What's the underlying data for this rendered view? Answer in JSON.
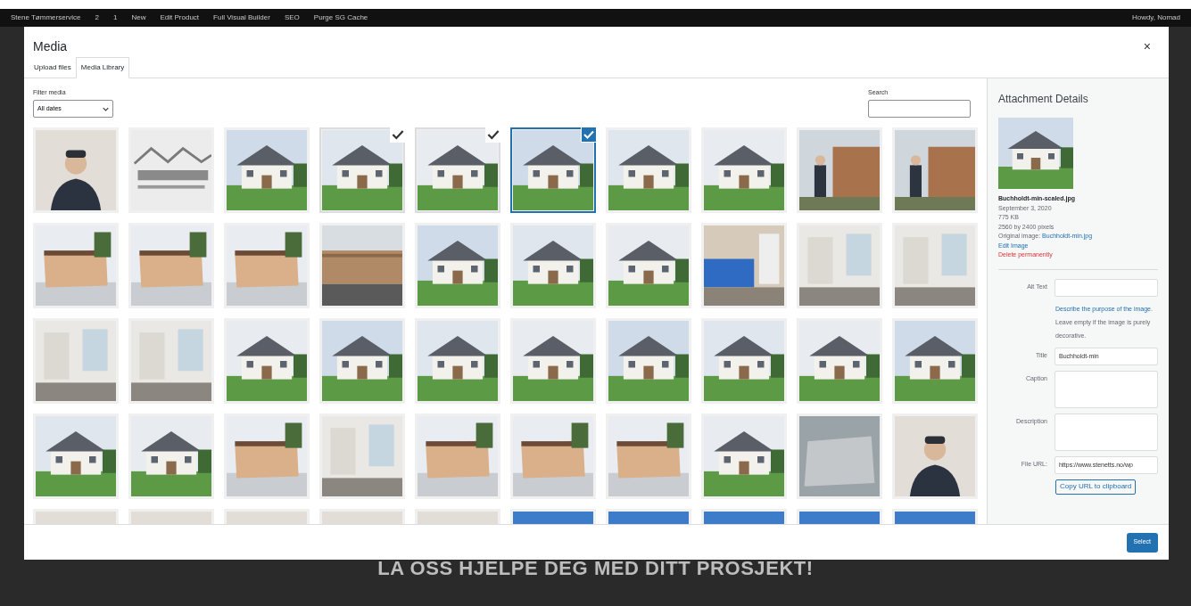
{
  "admin_bar": {
    "site": "Stene Tømmerservice",
    "updates": "2",
    "comments": "1",
    "new": "New",
    "edit": "Edit Product",
    "builder": "Full Visual Builder",
    "seo": "SEO",
    "cache": "Purge SG Cache",
    "greeting": "Howdy, Nomad"
  },
  "modal": {
    "title": "Media",
    "close": "×",
    "tabs": [
      {
        "label": "Upload files",
        "selected": false
      },
      {
        "label": "Media Library",
        "selected": true
      }
    ]
  },
  "filter": {
    "label": "Filter media",
    "value": "All dates"
  },
  "search": {
    "label": "Search"
  },
  "attachments": [
    {
      "selected": false,
      "current": false
    },
    {
      "selected": false,
      "current": false
    },
    {
      "selected": false,
      "current": false
    },
    {
      "selected": true,
      "current": false
    },
    {
      "selected": true,
      "current": false
    },
    {
      "selected": true,
      "current": true
    },
    {
      "selected": false,
      "current": false
    },
    {
      "selected": false,
      "current": false
    },
    {
      "selected": false,
      "current": false
    },
    {
      "selected": false,
      "current": false
    },
    {
      "selected": false,
      "current": false
    },
    {
      "selected": false,
      "current": false
    },
    {
      "selected": false,
      "current": false
    },
    {
      "selected": false,
      "current": false
    },
    {
      "selected": false,
      "current": false
    },
    {
      "selected": false,
      "current": false
    },
    {
      "selected": false,
      "current": false
    },
    {
      "selected": false,
      "current": false
    },
    {
      "selected": false,
      "current": false
    },
    {
      "selected": false,
      "current": false
    },
    {
      "selected": false,
      "current": false
    },
    {
      "selected": false,
      "current": false
    },
    {
      "selected": false,
      "current": false
    },
    {
      "selected": false,
      "current": false
    },
    {
      "selected": false,
      "current": false
    },
    {
      "selected": false,
      "current": false
    },
    {
      "selected": false,
      "current": false
    },
    {
      "selected": false,
      "current": false
    },
    {
      "selected": false,
      "current": false
    },
    {
      "selected": false,
      "current": false
    },
    {
      "selected": false,
      "current": false
    },
    {
      "selected": false,
      "current": false
    },
    {
      "selected": false,
      "current": false
    },
    {
      "selected": false,
      "current": false
    },
    {
      "selected": false,
      "current": false
    },
    {
      "selected": false,
      "current": false
    },
    {
      "selected": false,
      "current": false
    },
    {
      "selected": false,
      "current": false
    },
    {
      "selected": false,
      "current": false
    },
    {
      "selected": false,
      "current": false
    },
    {
      "selected": false,
      "current": false
    },
    {
      "selected": false,
      "current": false
    },
    {
      "selected": false,
      "current": false
    },
    {
      "selected": false,
      "current": false
    },
    {
      "selected": false,
      "current": false
    },
    {
      "selected": false,
      "current": false
    },
    {
      "selected": false,
      "current": false
    },
    {
      "selected": false,
      "current": false
    },
    {
      "selected": false,
      "current": false
    },
    {
      "selected": false,
      "current": false
    }
  ],
  "details": {
    "title": "Attachment Details",
    "filename": "Buchholdt-min-scaled.jpg",
    "date": "September 3, 2020",
    "size": "775 KB",
    "dimensions": "2560 by 2400 pixels",
    "original_label": "Original image:",
    "original_link": "Buchholdt-min.jpg",
    "edit": "Edit Image",
    "delete": "Delete permanently",
    "fields": [
      {
        "kind": "input",
        "label": "Alt Text"
      },
      {
        "kind": "help",
        "link": "Describe the purpose of the image",
        "text": ". Leave empty if the image is purely decorative."
      },
      {
        "kind": "input",
        "label": "Title",
        "value": "Buchholdt-min"
      },
      {
        "kind": "textarea",
        "label": "Caption"
      },
      {
        "kind": "textarea",
        "label": "Description"
      },
      {
        "kind": "input",
        "label": "File URL:",
        "value": "https://www.stenetts.no/wp"
      },
      {
        "kind": "button",
        "label": "Copy URL to clipboard"
      }
    ]
  },
  "select_button": "Select",
  "page_heading": "LA OSS HJELPE DEG MED DITT PROSJEKT!"
}
